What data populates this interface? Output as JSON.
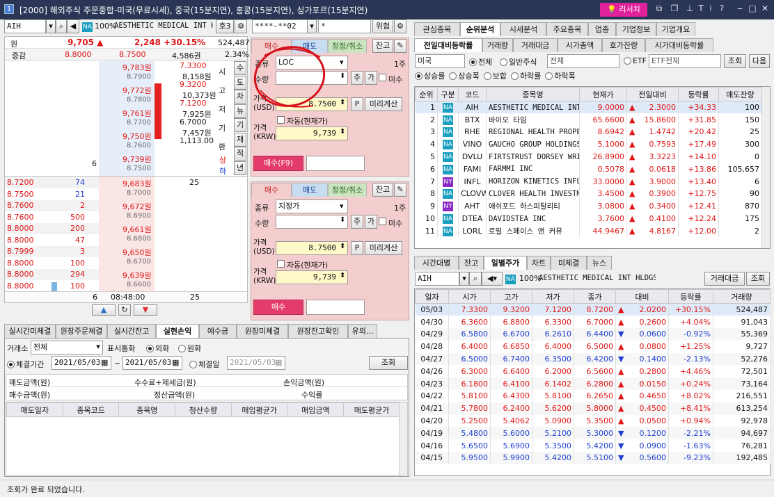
{
  "window": {
    "title": "[2000] 해외주식 주문종합-미국(무료시세), 중국(15분지연), 홍콩(15분지연), 싱가포르(15분지연)",
    "research": "리서치"
  },
  "left": {
    "code": "AIH",
    "na": "NA",
    "pct": "100%",
    "name": "AESTHETIC MEDICAL INT HL",
    "extra": "호3",
    "q1": {
      "label": "원",
      "price": "9,705 ▲",
      "change": "2,248 +30.15%",
      "volume": "524,487"
    },
    "q2": {
      "label": "증감",
      "a": "8.8000",
      "b": "8.7500",
      "c": "4,586권",
      "d": "2.34%"
    },
    "asks": [
      {
        "krw": "9,783원",
        "usd": "8.7900",
        "qty": ""
      },
      {
        "krw": "9,772원",
        "usd": "8.7800",
        "qty": ""
      },
      {
        "krw": "9,761원",
        "usd": "8.7700",
        "qty": ""
      },
      {
        "krw": "9,750원",
        "usd": "8.7600",
        "qty": ""
      },
      {
        "krw": "9,739원",
        "usd": "8.7500",
        "qty": "6"
      }
    ],
    "info": [
      {
        "v": "7.3300",
        "u": "8,158원",
        "k": "시"
      },
      {
        "v": "9.3200",
        "u": "10,373원",
        "k": "고"
      },
      {
        "v": "7.1200",
        "u": "7,925원",
        "k": "저"
      },
      {
        "v": "6.7000",
        "u": "7,457원",
        "k": "기"
      },
      {
        "v": "1,113.00",
        "u": "",
        "k": "환"
      }
    ],
    "side_labels": [
      "수",
      "도",
      "차",
      "뉴",
      "기",
      "재",
      "적",
      "년"
    ],
    "up_label": "상",
    "down_label": "하",
    "bids": [
      {
        "krw": "9,683원",
        "usd": "8.7000",
        "qty": "25"
      },
      {
        "krw": "9,672원",
        "usd": "8.6900",
        "qty": ""
      },
      {
        "krw": "9,661원",
        "usd": "8.6800",
        "qty": ""
      },
      {
        "krw": "9,650원",
        "usd": "8.6700",
        "qty": ""
      },
      {
        "krw": "9,639원",
        "usd": "8.6600",
        "qty": ""
      }
    ],
    "trades": [
      {
        "p": "8.7200",
        "q": "74"
      },
      {
        "p": "8.7500",
        "q": "21"
      },
      {
        "p": "8.7600",
        "q": "2"
      },
      {
        "p": "8.7600",
        "q": "500"
      },
      {
        "p": "8.8000",
        "q": "200"
      },
      {
        "p": "8.8000",
        "q": "47"
      },
      {
        "p": "8.7999",
        "q": "3"
      },
      {
        "p": "8.8000",
        "q": "100"
      },
      {
        "p": "8.8000",
        "q": "294"
      },
      {
        "p": "8.8000",
        "q": "100"
      }
    ],
    "footer": {
      "ask_total": "6",
      "time": "08:48:00",
      "bid_total": "25"
    }
  },
  "order": {
    "account": "****-**02",
    "pw": "*",
    "delegate": "위험",
    "tabs": [
      "매수",
      "매도",
      "정정/취소"
    ],
    "balance": "잔고",
    "top": {
      "type_label": "종류",
      "type": "LOC",
      "qty_label": "수량",
      "unit": "1주",
      "ju": "주",
      "ga": "가",
      "misu": "미수",
      "price_usd_label": "가격\n(USD)",
      "price_usd": "8.7500",
      "p_btn": "P",
      "precalc": "미리계산",
      "auto": "자동(현재가)",
      "price_krw_label": "가격\n(KRW)",
      "price_krw": "9,739",
      "submit": "매수(F9)"
    },
    "bottom": {
      "type_label": "종류",
      "type": "지정가",
      "qty_label": "수량",
      "unit": "1주",
      "ju": "주",
      "ga": "가",
      "misu": "미수",
      "price_usd_label": "가격\n(USD)",
      "price_usd": "8.7500",
      "p_btn": "P",
      "precalc": "미리계산",
      "auto": "자동(현재가)",
      "price_krw_label": "가격\n(KRW)",
      "price_krw": "9,739",
      "submit": "매수"
    }
  },
  "lower_left": {
    "tabs": [
      "실시간미체결",
      "원장주문체결",
      "실시간잔고",
      "실현손익",
      "예수금",
      "원장미체결",
      "원장잔고확인",
      "유의..."
    ],
    "exchange_label": "거래소",
    "exchange": "전체",
    "currency_label": "표시통화",
    "fx": "외화",
    "krw": "원화",
    "period_label": "체결기간",
    "from": "2021/05/03",
    "to": "2021/05/03",
    "day_label": "체결일",
    "day": "2021/05/03",
    "query": "조회",
    "sum": {
      "sell_amt": "매도금액(원)",
      "fee_tax": "수수료+제세금(원)",
      "pnl": "손익금액(원)",
      "buy_amt": "매수금액(원)",
      "settle": "정산금액(원)",
      "ret": "수익률"
    },
    "columns": [
      "매도일자",
      "종목코드",
      "종목명",
      "청산수량",
      "매입평균가",
      "매입금액",
      "매도평균가"
    ],
    "status": "조회가 완료 되었습니다."
  },
  "rank": {
    "tabs1": [
      "관심종목",
      "순위분석",
      "시세분석",
      "주요종목",
      "업종",
      "기업정보",
      "기업개요"
    ],
    "tabs2": [
      "전일대비등락률",
      "거래량",
      "거래대금",
      "시가총액",
      "호가잔량",
      "시가대비등락률"
    ],
    "market": "미국",
    "all": "전체",
    "general": "일반주식",
    "sector": "전체",
    "etf": "ETF",
    "etf_sel": "ETF전체",
    "query": "조회",
    "next": "다음",
    "filters": [
      "상승률",
      "상승폭",
      "보합",
      "하락률",
      "하락폭"
    ],
    "columns": [
      "순위",
      "구분",
      "코드",
      "종목명",
      "현재가",
      "전일대비",
      "등락률",
      "매도잔량"
    ],
    "rows": [
      {
        "rank": "1",
        "ex": "NA",
        "code": "AIH",
        "name": "AESTHETIC MEDICAL INT",
        "price": "9.0000",
        "chg": "2.3000",
        "rate": "+34.33",
        "ask": "100"
      },
      {
        "rank": "2",
        "ex": "NA",
        "code": "BTX",
        "name": "바이오 타임",
        "price": "65.6600",
        "chg": "15.8600",
        "rate": "+31.85",
        "ask": "150"
      },
      {
        "rank": "3",
        "ex": "NA",
        "code": "RHE",
        "name": "REGIONAL HEALTH PROPE",
        "price": "8.6942",
        "chg": "1.4742",
        "rate": "+20.42",
        "ask": "25"
      },
      {
        "rank": "4",
        "ex": "NA",
        "code": "VINO",
        "name": "GAUCHO GROUP HOLDINGS",
        "price": "5.1000",
        "chg": "0.7593",
        "rate": "+17.49",
        "ask": "300"
      },
      {
        "rank": "5",
        "ex": "NA",
        "code": "DVLU",
        "name": "FIRTSTRUST DORSEY WRI",
        "price": "26.8900",
        "chg": "3.3223",
        "rate": "+14.10",
        "ask": "0"
      },
      {
        "rank": "6",
        "ex": "NA",
        "code": "FAMI",
        "name": "FARMMI INC",
        "price": "0.5078",
        "chg": "0.0618",
        "rate": "+13.86",
        "ask": "105,657"
      },
      {
        "rank": "7",
        "ex": "NY",
        "code": "INFL",
        "name": "HORIZON KINETICS INFL",
        "price": "33.0000",
        "chg": "3.9000",
        "rate": "+13.40",
        "ask": "6"
      },
      {
        "rank": "8",
        "ex": "NA",
        "code": "CLOVW",
        "name": "CLOVER HEALTH INVESTM",
        "price": "3.4500",
        "chg": "0.3900",
        "rate": "+12.75",
        "ask": "90"
      },
      {
        "rank": "9",
        "ex": "NY",
        "code": "AHT",
        "name": "애쉬포드 하스피탈리티",
        "price": "3.0800",
        "chg": "0.3400",
        "rate": "+12.41",
        "ask": "870"
      },
      {
        "rank": "10",
        "ex": "NA",
        "code": "DTEA",
        "name": "DAVIDSTEA INC",
        "price": "3.7600",
        "chg": "0.4100",
        "rate": "+12.24",
        "ask": "175"
      },
      {
        "rank": "11",
        "ex": "NA",
        "code": "LORL",
        "name": "로럴 스페이스 앤 커뮤",
        "price": "44.9467",
        "chg": "4.8167",
        "rate": "+12.00",
        "ask": "2"
      }
    ]
  },
  "daily": {
    "tabs": [
      "시간대별",
      "잔고",
      "일별주가",
      "차트",
      "미체결",
      "뉴스"
    ],
    "code": "AIH",
    "na": "NA",
    "pct": "100%",
    "name": "AESTHETIC MEDICAL INT HLDGS",
    "amt_btn": "거래대금",
    "query": "조회",
    "columns": [
      "일자",
      "시가",
      "고가",
      "저가",
      "종가",
      "대비",
      "등락률",
      "거래량"
    ],
    "rows": [
      {
        "d": "05/03",
        "o": "7.3300",
        "h": "9.3200",
        "l": "7.1200",
        "c": "8.7200",
        "up": true,
        "chg": "2.0200",
        "rate": "+30.15%",
        "vol": "524,487"
      },
      {
        "d": "04/30",
        "o": "6.3600",
        "h": "6.8800",
        "l": "6.3300",
        "c": "6.7000",
        "up": true,
        "chg": "0.2600",
        "rate": "+4.04%",
        "vol": "91,043"
      },
      {
        "d": "04/29",
        "o": "6.5800",
        "h": "6.6700",
        "l": "6.2610",
        "c": "6.4400",
        "up": false,
        "chg": "0.0600",
        "rate": "-0.92%",
        "vol": "55,369"
      },
      {
        "d": "04/28",
        "o": "6.4000",
        "h": "6.6850",
        "l": "6.4000",
        "c": "6.5000",
        "up": true,
        "chg": "0.0800",
        "rate": "+1.25%",
        "vol": "9,727"
      },
      {
        "d": "04/27",
        "o": "6.5000",
        "h": "6.7400",
        "l": "6.3500",
        "c": "6.4200",
        "up": false,
        "chg": "0.1400",
        "rate": "-2.13%",
        "vol": "52,276"
      },
      {
        "d": "04/26",
        "o": "6.3000",
        "h": "6.6400",
        "l": "6.2000",
        "c": "6.5600",
        "up": true,
        "chg": "0.2800",
        "rate": "+4.46%",
        "vol": "72,501"
      },
      {
        "d": "04/23",
        "o": "6.1800",
        "h": "6.4100",
        "l": "6.1402",
        "c": "6.2800",
        "up": true,
        "chg": "0.0150",
        "rate": "+0.24%",
        "vol": "73,164"
      },
      {
        "d": "04/22",
        "o": "5.8100",
        "h": "6.4300",
        "l": "5.8100",
        "c": "6.2650",
        "up": true,
        "chg": "0.4650",
        "rate": "+8.02%",
        "vol": "216,551"
      },
      {
        "d": "04/21",
        "o": "5.7800",
        "h": "6.2400",
        "l": "5.6200",
        "c": "5.8000",
        "up": true,
        "chg": "0.4500",
        "rate": "+8.41%",
        "vol": "613,254"
      },
      {
        "d": "04/20",
        "o": "5.2500",
        "h": "5.4062",
        "l": "5.0900",
        "c": "5.3500",
        "up": true,
        "chg": "0.0500",
        "rate": "+0.94%",
        "vol": "92,978"
      },
      {
        "d": "04/19",
        "o": "5.4800",
        "h": "5.6000",
        "l": "5.2100",
        "c": "5.3000",
        "up": false,
        "chg": "0.1200",
        "rate": "-2.21%",
        "vol": "94,697"
      },
      {
        "d": "04/16",
        "o": "5.6500",
        "h": "5.6900",
        "l": "5.3500",
        "c": "5.4200",
        "up": false,
        "chg": "0.0900",
        "rate": "-1.63%",
        "vol": "76,281"
      },
      {
        "d": "04/15",
        "o": "5.9500",
        "h": "5.9900",
        "l": "5.4200",
        "c": "5.5100",
        "up": false,
        "chg": "0.5600",
        "rate": "-9.23%",
        "vol": "192,485"
      }
    ]
  }
}
